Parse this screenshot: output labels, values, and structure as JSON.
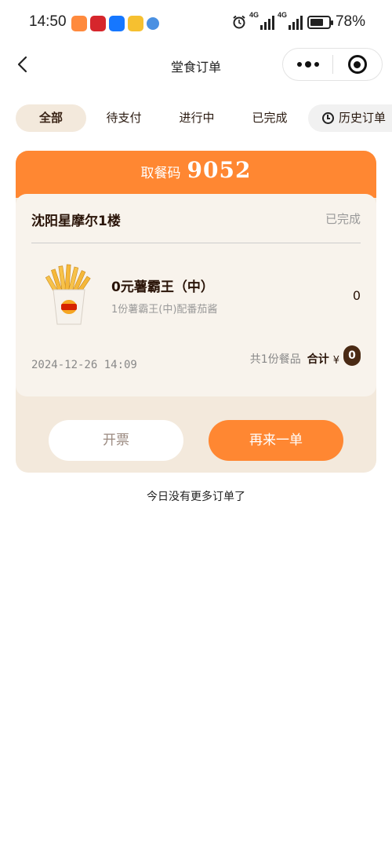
{
  "status_bar": {
    "time": "14:50",
    "network": "4G",
    "network2": "4G",
    "battery": "78%",
    "battery_level": 0.78,
    "app_icons": [
      "taobao-icon",
      "bank-icon",
      "alipay-icon",
      "mail-icon",
      "browser-icon"
    ]
  },
  "nav": {
    "title": "堂食订单"
  },
  "tabs": [
    {
      "label": "全部",
      "active": true
    },
    {
      "label": "待支付",
      "active": false
    },
    {
      "label": "进行中",
      "active": false
    },
    {
      "label": "已完成",
      "active": false
    },
    {
      "label": "历史订单",
      "active": false
    }
  ],
  "order": {
    "pickup_label": "取餐码",
    "pickup_code": "9052",
    "store": "沈阳星摩尔1楼",
    "status": "已完成",
    "item": {
      "name": "0元薯霸王（中）",
      "desc": "1份薯霸王(中)配番茄酱",
      "price": "0"
    },
    "date": "2024-12-26 14:09",
    "count_text": "共1份餐品",
    "total_label": "合计",
    "currency": "¥",
    "total": "0",
    "invoice_label": "开票",
    "reorder_label": "再来一单"
  },
  "footer": {
    "no_more": "今日没有更多订单了"
  },
  "colors": {
    "accent": "#ff8732",
    "card_bg": "#f3e9dc",
    "text_dark": "#2a1408"
  }
}
